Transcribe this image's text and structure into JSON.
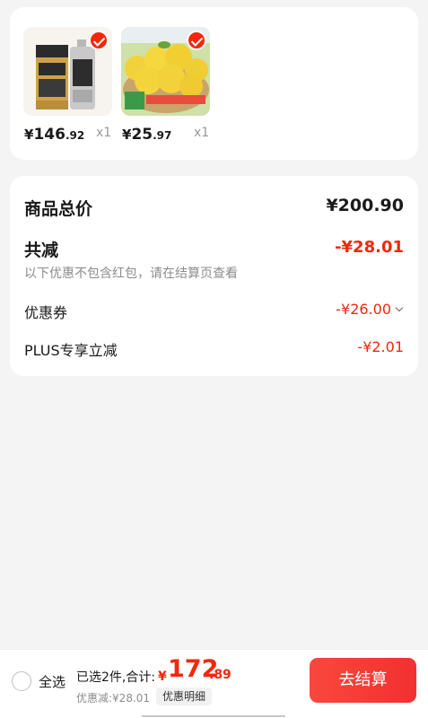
{
  "products": [
    {
      "price_currency": "¥",
      "price_int": "146",
      "price_dec": ".92",
      "qty": "x1",
      "selected": true,
      "icon": "motor-oil-product-image"
    },
    {
      "price_currency": "¥",
      "price_int": "25",
      "price_dec": ".97",
      "qty": "x1",
      "selected": true,
      "icon": "yellow-peach-product-image"
    }
  ],
  "summary": {
    "total_label": "商品总价",
    "total_value": "¥200.90",
    "reduce_label": "共减",
    "reduce_value": "-¥28.01",
    "reduce_note": "以下优惠不包含红包，请在结算页查看",
    "coupon_label": "优惠券",
    "coupon_value": "-¥26.00",
    "plus_label": "PLUS专享立减",
    "plus_value": "-¥2.01"
  },
  "bottom": {
    "select_all": "全选",
    "selected_info": "已选2件,合计:",
    "sum_currency": "¥",
    "sum_int": "172",
    "sum_dec": ".89",
    "discount": "优惠减:¥28.01",
    "detail_button": "优惠明细",
    "checkout_button": "去结算"
  },
  "colors": {
    "accent": "#f2270c",
    "background": "#f4f4f4"
  }
}
